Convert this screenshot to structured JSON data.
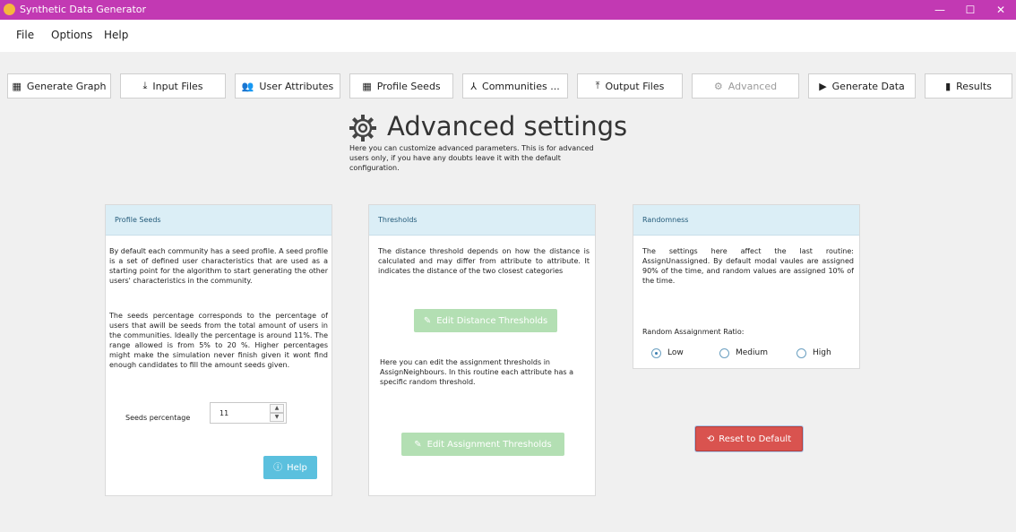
{
  "window": {
    "title": "Synthetic Data Generator",
    "controls": {
      "minimize": "—",
      "maximize": "☐",
      "close": "✕"
    }
  },
  "menu": [
    "File",
    "Options",
    "Help"
  ],
  "toolbar": {
    "generate_graph": "Generate Graph",
    "input_files": "Input Files",
    "user_attributes": "User Attributes",
    "profile_seeds": "Profile Seeds",
    "communities": "Communities ...",
    "output_files": "Output Files",
    "advanced": "Advanced",
    "generate_data": "Generate Data",
    "results": "Results"
  },
  "header": {
    "title": "Advanced settings",
    "description": "Here you can customize advanced parameters. This is for advanced users only, if you have any doubts leave it with the default configuration."
  },
  "profile_seeds": {
    "heading": "Profile Seeds",
    "para1": "By default each community has a seed profile. A seed profile is a set of defined user characteristics that are used as a starting point for the algorithm to start generating the other users' characteristics in the community.",
    "para2": "The seeds percentage corresponds to the percentage of users that awill be seeds from the total amount of users in the communities. Ideally the percentage is around 11%.  The range allowed is from 5% to 20 %. Higher percentages might make the simulation never finish given it wont find enough candidates to fill the amount seeds given.",
    "seeds_label": "Seeds percentage",
    "seeds_value": "11",
    "help_label": "Help"
  },
  "thresholds": {
    "heading": "Thresholds",
    "para1": "The distance threshold depends on how the distance is calculated and may differ from attribute to attribute. It indicates the distance of the two closest categories",
    "distance_button": "Edit Distance Thresholds",
    "para2": "Here you can edit the assignment thresholds in AssignNeighbours. In this routine each attribute has a specific random threshold.",
    "assignment_button": "Edit Assignment Thresholds"
  },
  "randomness": {
    "heading": "Randomness",
    "para": "The settings here affect the last routine: AssignUnassigned. By default modal vaules are assigned 90% of the time, and random values are assigned 10% of the time.",
    "ratio_label": "Random Assaignment Ratio:",
    "options": [
      "Low",
      "Medium",
      "High"
    ],
    "selected": "Low"
  },
  "reset_button": "Reset to Default",
  "colors": {
    "titlebar": "#c239b3",
    "card_header": "#dbeef6",
    "help": "#5bc0de",
    "green_disabled": "#b3dfb3",
    "danger": "#d9534f"
  }
}
